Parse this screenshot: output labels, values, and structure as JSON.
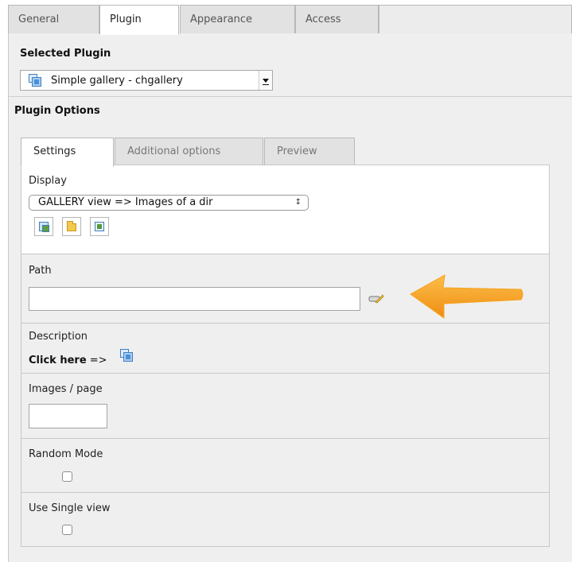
{
  "tabs": [
    "General",
    "Plugin",
    "Appearance",
    "Access"
  ],
  "selected_plugin": {
    "heading": "Selected Plugin",
    "value": "Simple gallery - chgallery",
    "icon": "gallery-icon"
  },
  "plugin_options": {
    "heading": "Plugin Options",
    "tabs": [
      "Settings",
      "Additional options",
      "Preview"
    ]
  },
  "display": {
    "label": "Display",
    "value": "GALLERY view => Images of a dir",
    "buttons": [
      "gallery-icon",
      "folder-icon",
      "image-icon"
    ]
  },
  "path": {
    "label": "Path",
    "value": "",
    "wizard_icon": "pencil-wizard-icon"
  },
  "annotation": {
    "color": "#f7a21b"
  },
  "description": {
    "label": "Description",
    "link_bold": "Click here",
    "link_suffix": "=>"
  },
  "images_per_page": {
    "label": "Images / page",
    "value": ""
  },
  "random_mode": {
    "label": "Random Mode",
    "checked": false
  },
  "single_view": {
    "label": "Use Single view",
    "checked": false
  }
}
